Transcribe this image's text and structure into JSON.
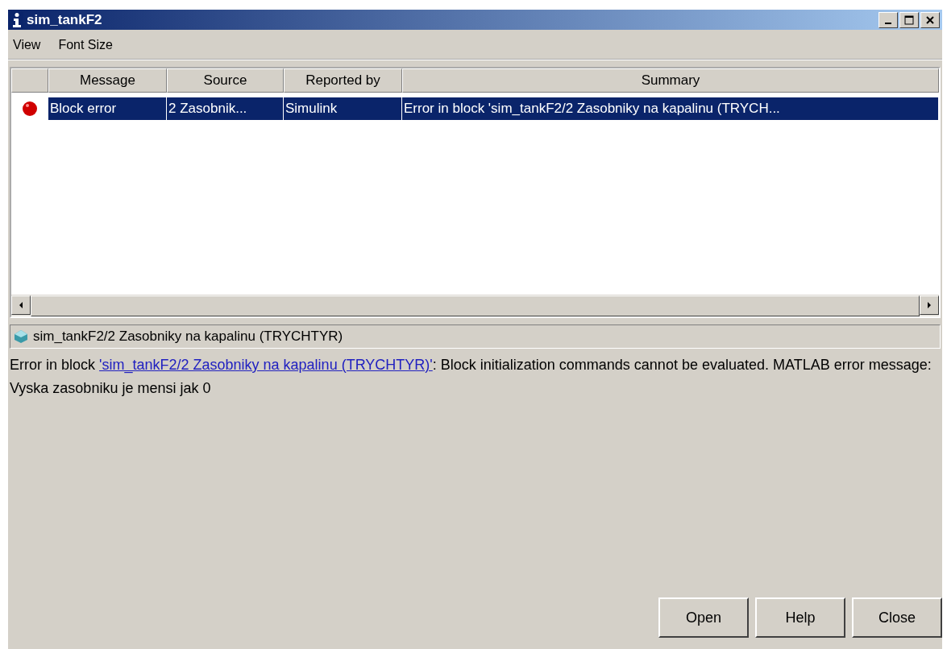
{
  "window": {
    "title": "sim_tankF2"
  },
  "menu": [
    "View",
    "Font Size"
  ],
  "table": {
    "columns": [
      "Message",
      "Source",
      "Reported by",
      "Summary"
    ],
    "rows": [
      {
        "kind": "error",
        "selected": true,
        "cells": [
          "Block error",
          "2 Zasobnik...",
          "Simulink",
          "Error in block 'sim_tankF2/2 Zasobniky  na kapalinu (TRYCH..."
        ]
      }
    ]
  },
  "path": "sim_tankF2/2 Zasobniky  na kapalinu (TRYCHTYR)",
  "details": {
    "before": "Error in block ",
    "link": "'sim_tankF2/2 Zasobniky  na kapalinu (TRYCHTYR)'",
    "after": ": Block initialization commands cannot be evaluated.  MATLAB error message: Vyska zasobniku je mensi jak 0"
  },
  "buttons": [
    "Open",
    "Help",
    "Close"
  ]
}
